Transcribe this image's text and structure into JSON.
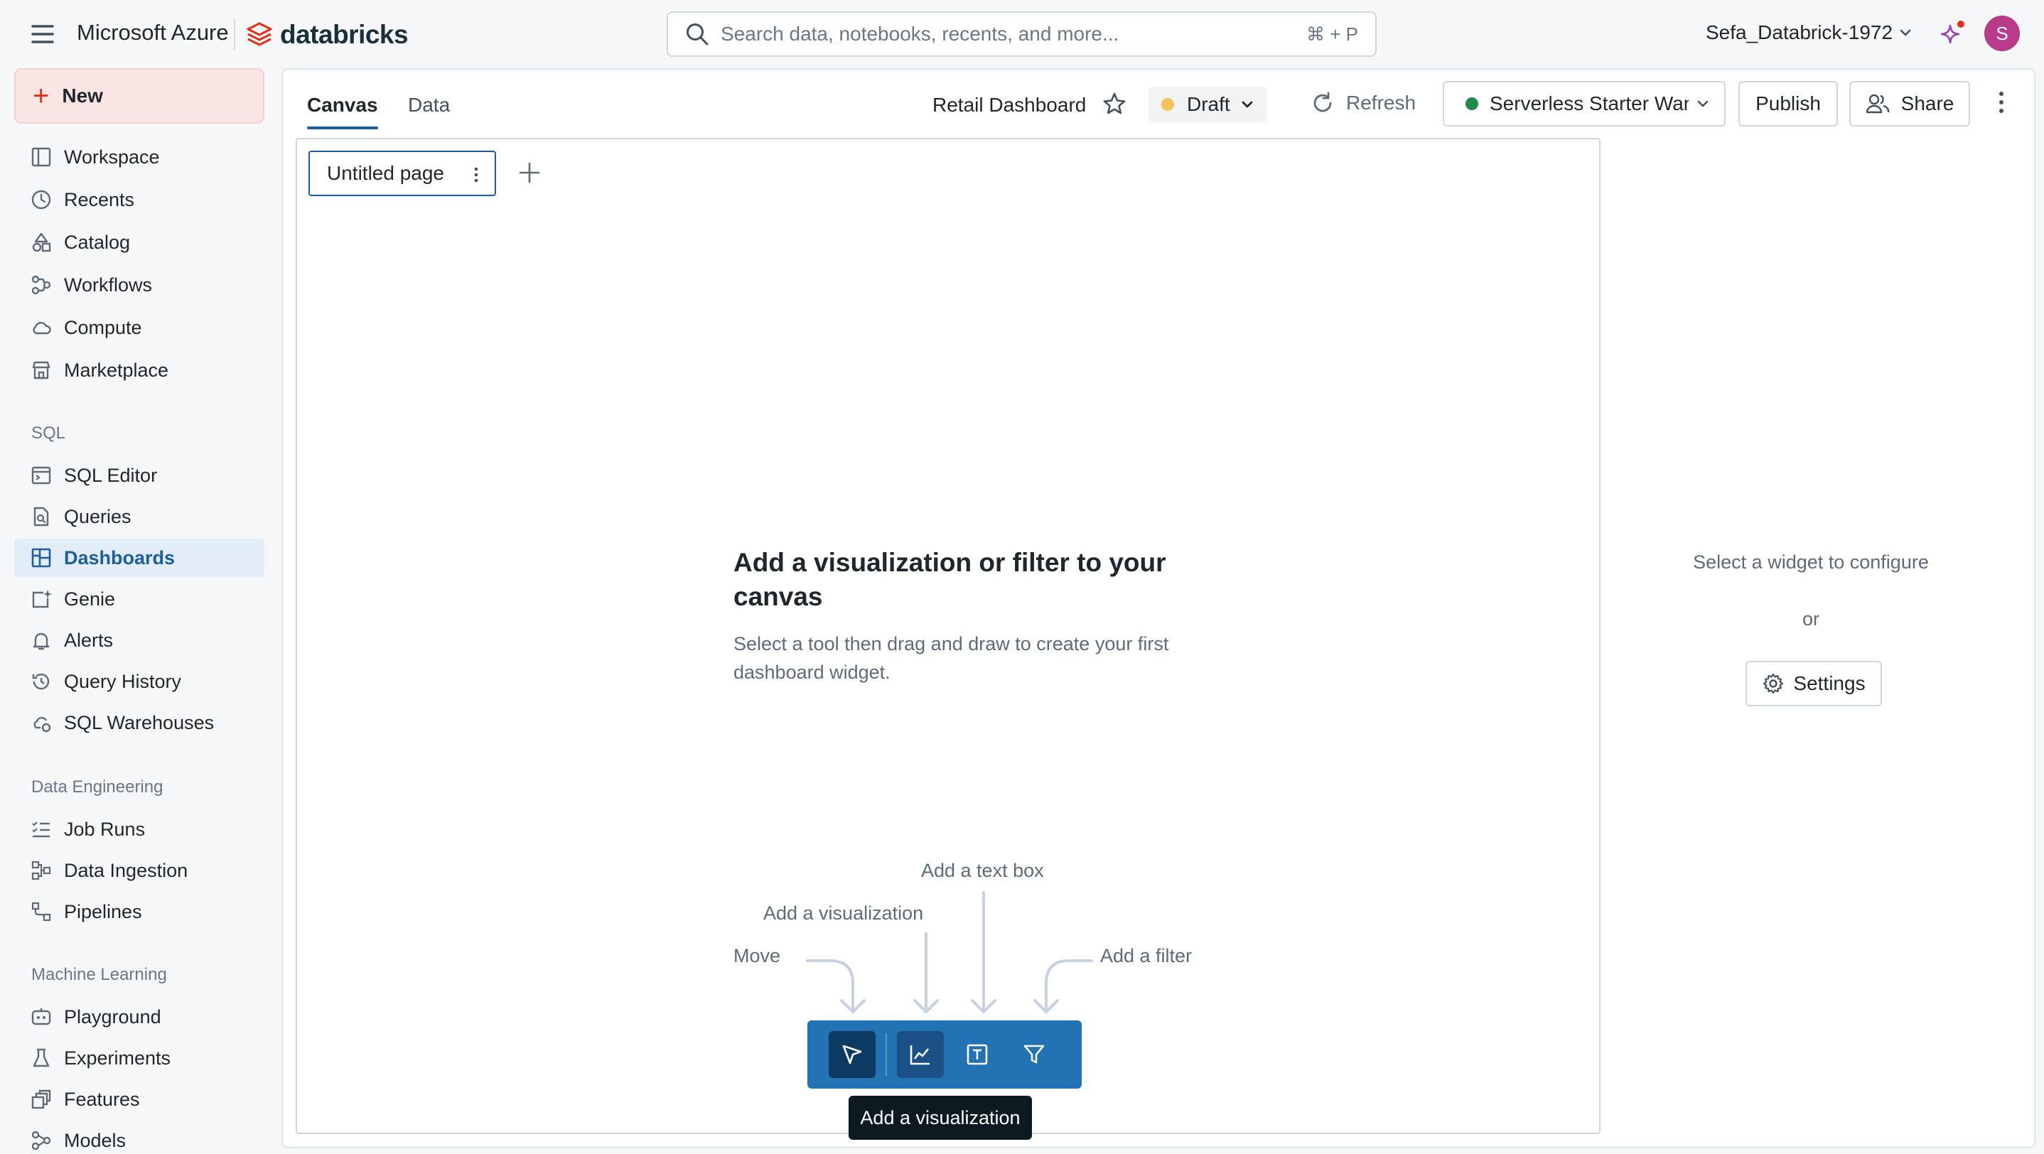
{
  "topbar": {
    "cloud_name": "Microsoft Azure",
    "brand": "databricks",
    "search_placeholder": "Search data, notebooks, recents, and more...",
    "search_shortcut": "⌘ + P",
    "workspace": "Sefa_Databrick-1972",
    "avatar_initial": "S"
  },
  "sidebar": {
    "new_label": "New",
    "items": [
      {
        "label": "Workspace",
        "icon": "workspace-icon"
      },
      {
        "label": "Recents",
        "icon": "clock-icon"
      },
      {
        "label": "Catalog",
        "icon": "catalog-icon"
      },
      {
        "label": "Workflows",
        "icon": "workflows-icon"
      },
      {
        "label": "Compute",
        "icon": "cloud-icon"
      },
      {
        "label": "Marketplace",
        "icon": "store-icon"
      }
    ],
    "sql_section": "SQL",
    "sql_items": [
      {
        "label": "SQL Editor",
        "icon": "sql-editor-icon"
      },
      {
        "label": "Queries",
        "icon": "query-file-icon"
      },
      {
        "label": "Dashboards",
        "icon": "dashboard-icon",
        "active": true
      },
      {
        "label": "Genie",
        "icon": "genie-icon"
      },
      {
        "label": "Alerts",
        "icon": "bell-icon"
      },
      {
        "label": "Query History",
        "icon": "history-icon"
      },
      {
        "label": "SQL Warehouses",
        "icon": "warehouse-icon"
      }
    ],
    "de_section": "Data Engineering",
    "de_items": [
      {
        "label": "Job Runs",
        "icon": "job-runs-icon"
      },
      {
        "label": "Data Ingestion",
        "icon": "ingestion-icon"
      },
      {
        "label": "Pipelines",
        "icon": "pipeline-icon"
      }
    ],
    "ml_section": "Machine Learning",
    "ml_items": [
      {
        "label": "Playground",
        "icon": "playground-icon"
      },
      {
        "label": "Experiments",
        "icon": "flask-icon"
      },
      {
        "label": "Features",
        "icon": "features-icon"
      },
      {
        "label": "Models",
        "icon": "models-icon"
      }
    ]
  },
  "header": {
    "tabs": [
      {
        "label": "Canvas",
        "active": true
      },
      {
        "label": "Data",
        "active": false
      }
    ],
    "dashboard_title": "Retail Dashboard",
    "status": "Draft",
    "status_color": "#f6c25b",
    "refresh_label": "Refresh",
    "warehouse": "Serverless Starter Warehouse",
    "publish_label": "Publish",
    "share_label": "Share"
  },
  "canvas": {
    "page_tab": "Untitled page",
    "empty_title": "Add a visualization or filter to your canvas",
    "empty_subtitle": "Select a tool then drag and draw to create your first dashboard widget.",
    "hints": {
      "move": "Move",
      "visualization": "Add a visualization",
      "text_box": "Add a text box",
      "filter": "Add a filter"
    },
    "tooltip": "Add a visualization",
    "accent_color": "#2272b4"
  },
  "right_panel": {
    "prompt": "Select a widget to configure",
    "or": "or",
    "settings_label": "Settings"
  }
}
